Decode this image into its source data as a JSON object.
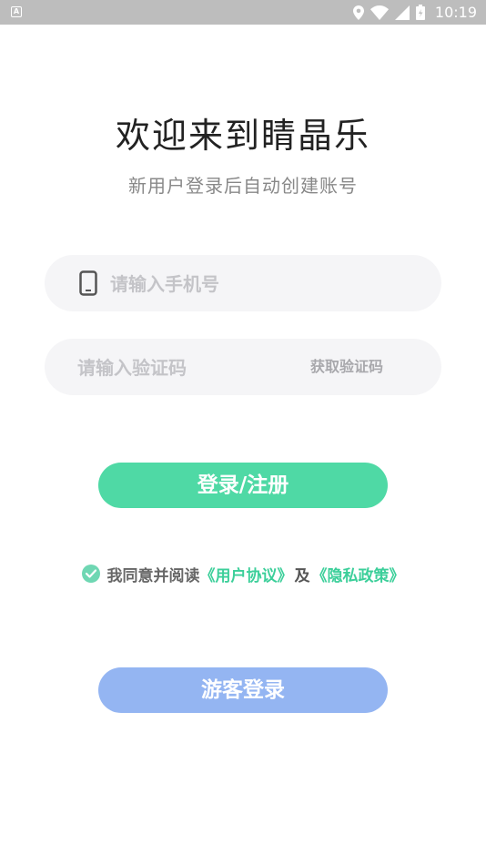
{
  "status_bar": {
    "time": "10:19",
    "app_icon_letter": "A"
  },
  "header": {
    "title": "欢迎来到睛晶乐",
    "subtitle": "新用户登录后自动创建账号"
  },
  "form": {
    "phone_placeholder": "请输入手机号",
    "code_placeholder": "请输入验证码",
    "get_code_label": "获取验证码"
  },
  "buttons": {
    "login_label": "登录/注册",
    "guest_label": "游客登录"
  },
  "agreement": {
    "checked": true,
    "prefix": "我同意并阅读",
    "user_agreement": "《用户协议》",
    "and": "及",
    "privacy_policy": "《隐私政策》"
  },
  "colors": {
    "primary_green": "#4fd9a5",
    "guest_blue": "#94b5f2",
    "link_green": "#3ccf9a"
  }
}
